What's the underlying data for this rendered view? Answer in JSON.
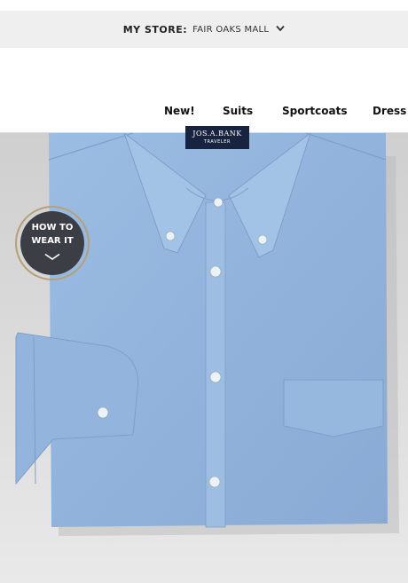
{
  "store": {
    "label": "MY STORE:",
    "value": "FAIR OAKS MALL"
  },
  "nav": {
    "items": [
      "New!",
      "Suits",
      "Sportcoats",
      "Dress S"
    ]
  },
  "product": {
    "brand_tag": "JOS.A.BANK",
    "brand_sub": "TRAVELER",
    "shirt_color": "#94b6de"
  },
  "how_to": {
    "line1": "HOW TO",
    "line2": "WEAR IT"
  },
  "colors": {
    "accent_gold": "#b7a075",
    "badge_dark": "#3b3e44",
    "tag_navy": "#17233f"
  }
}
